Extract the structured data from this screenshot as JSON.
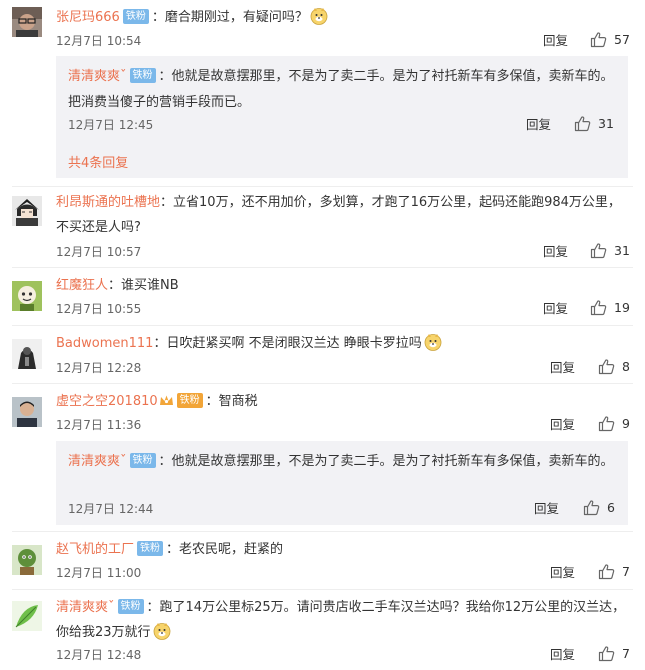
{
  "labels": {
    "reply": "回复",
    "colon": "："
  },
  "comments": [
    {
      "user": "张尼玛666",
      "badge": "铁粉",
      "text": "磨合期刚过，有疑问吗？",
      "time": "12月7日 10:54",
      "likes": "57",
      "avatar_icon": "glasses-man-avatar",
      "replies": [
        {
          "user": "清清爽爽ˇ",
          "badge": "铁粉",
          "text": "他就是故意摆那里，不是为了卖二手。是为了衬托新车有多保值，卖新车的。把消费当傻子的营销手段而已。",
          "time": "12月7日 12:45",
          "likes": "31"
        }
      ],
      "more_replies": "共4条回复"
    },
    {
      "user": "利昂斯通的吐槽地",
      "text": "立省10万，还不用加价，多划算，才跑了16万公里，起码还能跑984万公里，不买还是人吗?",
      "time": "12月7日 10:57",
      "likes": "31",
      "avatar_icon": "anime-character-avatar"
    },
    {
      "user": "红魔狂人",
      "text": "谁买谁NB",
      "time": "12月7日 10:55",
      "likes": "19",
      "avatar_icon": "cartoon-character-avatar"
    },
    {
      "user": "Badwomen111",
      "text": "日吹赶紧买啊  不是闭眼汉兰达 睁眼卡罗拉吗",
      "time": "12月7日 12:28",
      "likes": "8",
      "avatar_icon": "dark-figure-avatar"
    },
    {
      "user": "虚空之空201810",
      "badge": "铁粉",
      "text": "智商税",
      "time": "12月7日 11:36",
      "likes": "9",
      "avatar_icon": "man-photo-avatar",
      "replies": [
        {
          "user": "清清爽爽ˇ",
          "badge": "铁粉",
          "text": "他就是故意摆那里，不是为了卖二手。是为了衬托新车有多保值，卖新车的。",
          "time": "12月7日 12:44",
          "likes": "6"
        }
      ]
    },
    {
      "user": "赵飞机的工厂",
      "badge": "铁粉",
      "text": "老农民呢，赶紧的",
      "time": "12月7日 11:00",
      "likes": "7",
      "avatar_icon": "green-cartoon-avatar"
    },
    {
      "user": "清清爽爽ˇ",
      "badge": "铁粉",
      "text": "跑了14万公里标25万。请问贵店收二手车汉兰达吗？我给你12万公里的汉兰达，你给我23万就行",
      "time": "12月7日 12:48",
      "likes": "7",
      "avatar_icon": "green-leaf-avatar"
    }
  ]
}
